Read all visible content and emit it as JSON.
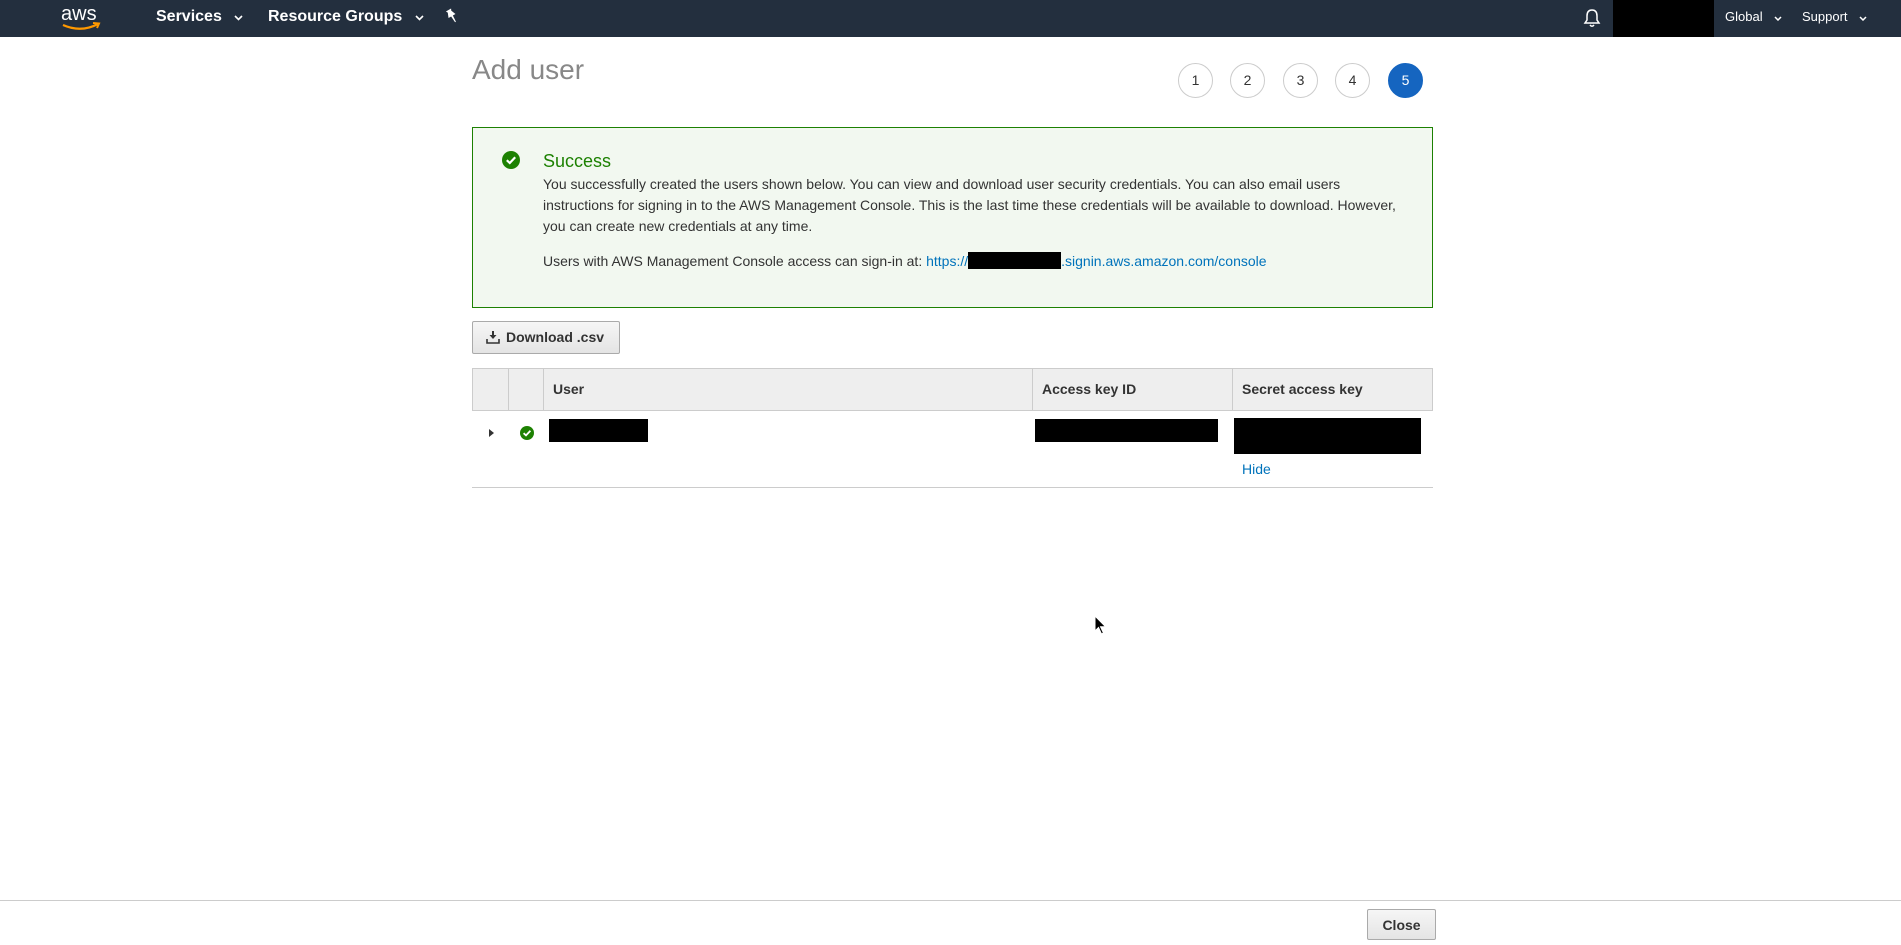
{
  "nav": {
    "logo_text": "aws",
    "services_label": "Services",
    "resource_groups_label": "Resource Groups",
    "region_label": "Global",
    "support_label": "Support"
  },
  "page": {
    "title": "Add user",
    "steps": [
      "1",
      "2",
      "3",
      "4",
      "5"
    ],
    "active_step": "5"
  },
  "success": {
    "title": "Success",
    "message": "You successfully created the users shown below. You can view and download user security credentials. You can also email users instructions for signing in to the AWS Management Console. This is the last time these credentials will be available to download. However, you can create new credentials at any time.",
    "signin_prefix": "Users with AWS Management Console access can sign-in at: ",
    "link_start": "https://",
    "link_end": ".signin.aws.amazon.com/console"
  },
  "actions": {
    "download_label": "Download .csv"
  },
  "table": {
    "columns": [
      "User",
      "Access key ID",
      "Secret access key"
    ],
    "hide_label": "Hide"
  },
  "footer": {
    "close_label": "Close"
  },
  "colors": {
    "nav_bg": "#232f3e",
    "success_green": "#1d8102",
    "success_bg": "#f2f8f0",
    "link_blue": "#0073bb",
    "active_step": "#1565c0"
  }
}
